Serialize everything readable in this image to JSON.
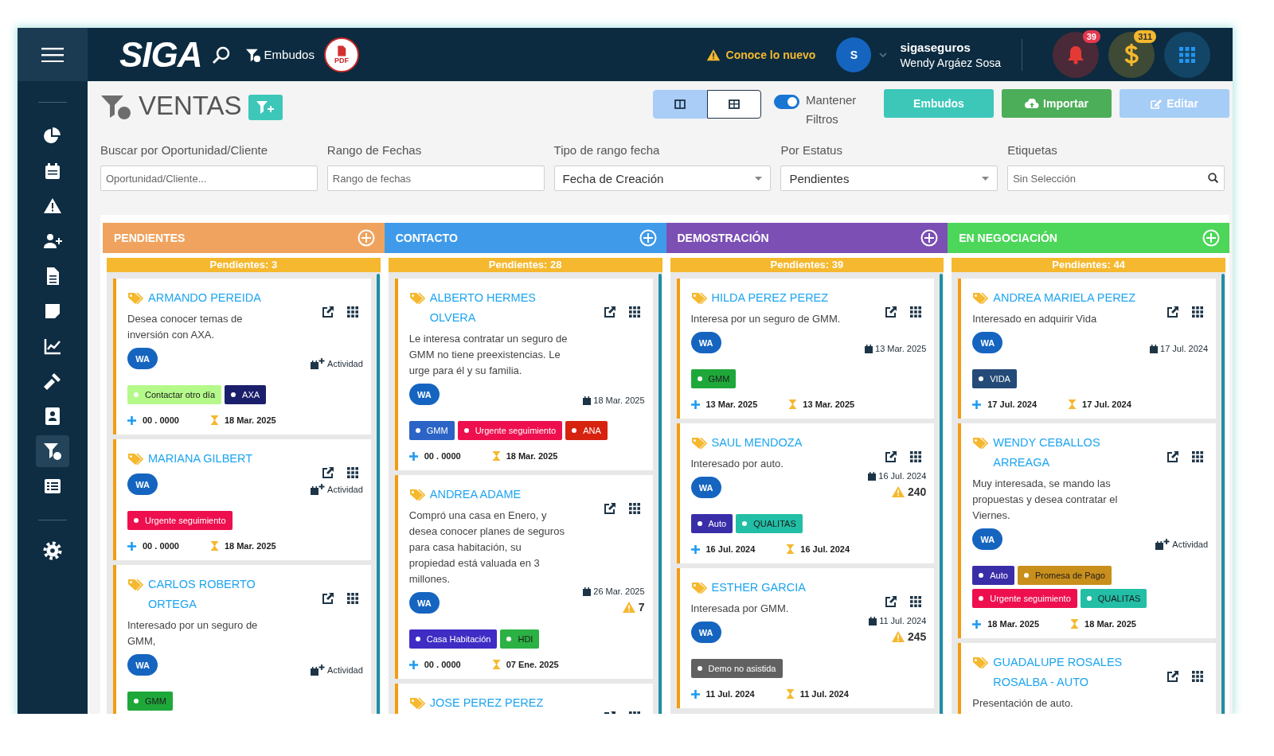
{
  "topbar": {
    "logo": "SIGA",
    "nav_link": "Embudos",
    "pdf_label": "PDF",
    "notice": "Conoce lo nuevo",
    "user": {
      "initial": "S",
      "company": "sigaseguros",
      "name": "Wendy Argáez Sosa"
    },
    "notifications": "39",
    "payments": "311"
  },
  "sidebar": {
    "items": [
      {
        "selected": false
      },
      {
        "selected": false
      },
      {
        "selected": false
      },
      {
        "selected": false
      },
      {
        "selected": false
      },
      {
        "selected": false
      },
      {
        "selected": false
      },
      {
        "selected": false
      },
      {
        "selected": false
      },
      {
        "selected": true
      },
      {
        "selected": false
      }
    ]
  },
  "header": {
    "title": "VENTAS",
    "views": [
      {
        "selected": true
      },
      {
        "selected": false
      }
    ],
    "keep_filters": {
      "label": "Mantener Filtros",
      "on": true
    },
    "buttons": [
      {
        "label": "Embudos",
        "color": "#3cc7b9",
        "kind": "plain"
      },
      {
        "label": "Importar",
        "color": "#4cae58",
        "kind": "import"
      },
      {
        "label": "Editar",
        "color": "#a6cdf5",
        "kind": "edit"
      }
    ]
  },
  "filters": [
    {
      "label": "Buscar por Oportunidad/Cliente",
      "kind": "text",
      "placeholder": "Oportunidad/Cliente..."
    },
    {
      "label": "Rango de Fechas",
      "kind": "text",
      "placeholder": "Rango de fechas"
    },
    {
      "label": "Tipo de rango fecha",
      "kind": "select",
      "value": "Fecha de Creación"
    },
    {
      "label": "Por Estatus",
      "kind": "select",
      "value": "Pendientes"
    },
    {
      "label": "Etiquetas",
      "kind": "search",
      "placeholder": "Sin Selección"
    }
  ],
  "columns": [
    {
      "name": "PENDIENTES",
      "color": "#f0a35e",
      "count": "Pendientes: 3",
      "cards": [
        {
          "name": "ARMANDO PEREIDA",
          "description": "Desea conocer temas de inversión con AXA.",
          "channel": "WA",
          "meta": {
            "kind": "activity",
            "text": "Actividad"
          },
          "tags": [
            {
              "label": "Contactar otro día",
              "color": "#b4f98a"
            },
            {
              "label": "AXA",
              "color": "#1b1f6b"
            }
          ],
          "amount": "00 . 0000",
          "due": "18 Mar. 2025"
        },
        {
          "name": "MARIANA GILBERT",
          "channel": "WA",
          "meta": {
            "kind": "activity",
            "text": "Actividad"
          },
          "tags": [
            {
              "label": "Urgente seguimiento",
              "color": "#ee0f4f"
            }
          ],
          "amount": "00 . 0000",
          "due": "18 Mar. 2025"
        },
        {
          "name": "CARLOS ROBERTO ORTEGA",
          "description": "Interesado por un seguro de GMM,",
          "channel": "WA",
          "meta": {
            "kind": "activity",
            "text": "Actividad"
          },
          "tags": [
            {
              "label": "GMM",
              "color": "#1fa83a"
            }
          ]
        }
      ]
    },
    {
      "name": "CONTACTO",
      "color": "#3f9bea",
      "count": "Pendientes: 28",
      "cards": [
        {
          "name": "ALBERTO HERMES OLVERA",
          "description": "Le interesa contratar un seguro de GMM no tiene preexistencias. Le urge para él y su familia.",
          "channel": "WA",
          "meta": {
            "kind": "date",
            "text": "18 Mar. 2025"
          },
          "tags": [
            {
              "label": "GMM",
              "color": "#2b63c6"
            },
            {
              "label": "Urgente seguimiento",
              "color": "#ee0f4f"
            },
            {
              "label": "ANA",
              "color": "#d6220f"
            }
          ],
          "amount": "00 . 0000",
          "due": "18 Mar. 2025"
        },
        {
          "name": "ANDREA ADAME",
          "description": "Compró una casa en Enero, y desea conocer planes de seguros para casa habitación, su propiedad está valuada en 3 millones.",
          "channel": "WA",
          "meta": {
            "kind": "date",
            "text": "26 Mar. 2025"
          },
          "warning": "7",
          "tags": [
            {
              "label": "Casa Habitación",
              "color": "#3f2cc4"
            },
            {
              "label": "HDI",
              "color": "#2bb144"
            }
          ],
          "amount": "00 . 0000",
          "due": "07 Ene. 2025"
        },
        {
          "name": "JOSE PEREZ PEREZ"
        }
      ]
    },
    {
      "name": "DEMOSTRACIÓN",
      "color": "#7b4fb4",
      "count": "Pendientes: 39",
      "cards": [
        {
          "name": "HILDA PEREZ PEREZ",
          "description": "Interesa por un seguro de GMM.",
          "channel": "WA",
          "meta": {
            "kind": "date",
            "text": "13 Mar. 2025"
          },
          "tags": [
            {
              "label": "GMM",
              "color": "#1fa83a"
            }
          ],
          "amount": "13 Mar. 2025",
          "due": "13 Mar. 2025"
        },
        {
          "name": "SAUL MENDOZA",
          "description": "Interesado por auto.",
          "channel": "WA",
          "meta": {
            "kind": "date",
            "text": "16 Jul. 2024"
          },
          "warning": "240",
          "tags": [
            {
              "label": "Auto",
              "color": "#3a2ea8"
            },
            {
              "label": "QUALITAS",
              "color": "#22bea6"
            }
          ],
          "amount": "16 Jul. 2024",
          "due": "16 Jul. 2024"
        },
        {
          "name": "ESTHER GARCIA",
          "description": "Interesada por GMM.",
          "channel": "WA",
          "meta": {
            "kind": "date",
            "text": "11 Jul. 2024"
          },
          "warning": "245",
          "tags": [
            {
              "label": "Demo no asistida",
              "color": "#616161"
            }
          ],
          "amount": "11 Jul. 2024",
          "due": "11 Jul. 2024"
        }
      ]
    },
    {
      "name": "EN NEGOCIACIÓN",
      "color": "#4cd65a",
      "count": "Pendientes: 44",
      "cards": [
        {
          "name": "ANDREA MARIELA PEREZ",
          "description": "Interesado en adquirir Vida",
          "channel": "WA",
          "meta": {
            "kind": "date",
            "text": "17 Jul. 2024"
          },
          "tags": [
            {
              "label": "VIDA",
              "color": "#244a77"
            }
          ],
          "amount": "17 Jul. 2024",
          "due": "17 Jul. 2024"
        },
        {
          "name": "WENDY CEBALLOS ARREAGA",
          "description": "Muy interesada, se mando las propuestas y desea contratar el Viernes.",
          "channel": "WA",
          "meta": {
            "kind": "activity",
            "text": "Actividad"
          },
          "tags": [
            {
              "label": "Auto",
              "color": "#3a2ea8"
            },
            {
              "label": "Promesa de Pago",
              "color": "#c98f1c"
            },
            {
              "label": "Urgente seguimiento",
              "color": "#ee0f4f"
            },
            {
              "label": "QUALITAS",
              "color": "#22bea6"
            }
          ],
          "amount": "18 Mar. 2025",
          "due": "18 Mar. 2025"
        },
        {
          "name": "GUADALUPE ROSALES ROSALBA - AUTO",
          "description": "Presentación de auto."
        }
      ]
    }
  ]
}
